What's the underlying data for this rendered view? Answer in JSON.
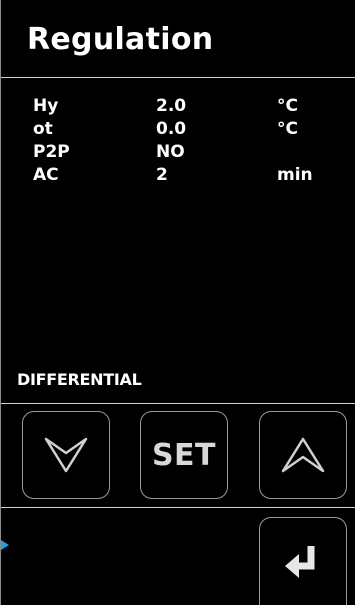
{
  "header": {
    "title": "Regulation"
  },
  "params": [
    {
      "name": "Hy",
      "value": "2.0",
      "unit": "°C"
    },
    {
      "name": "ot",
      "value": "0.0",
      "unit": "°C"
    },
    {
      "name": "P2P",
      "value": "NO",
      "unit": ""
    },
    {
      "name": "AC",
      "value": "2",
      "unit": "min"
    }
  ],
  "status": {
    "label": "DIFFERENTIAL"
  },
  "buttons": {
    "down_icon": "chevron-down-icon",
    "set_label": "SET",
    "up_icon": "chevron-up-icon",
    "enter_icon": "enter-return-icon"
  },
  "colors": {
    "background": "#000000",
    "text": "#ffffff",
    "accent_marker": "#1ea3dd"
  }
}
